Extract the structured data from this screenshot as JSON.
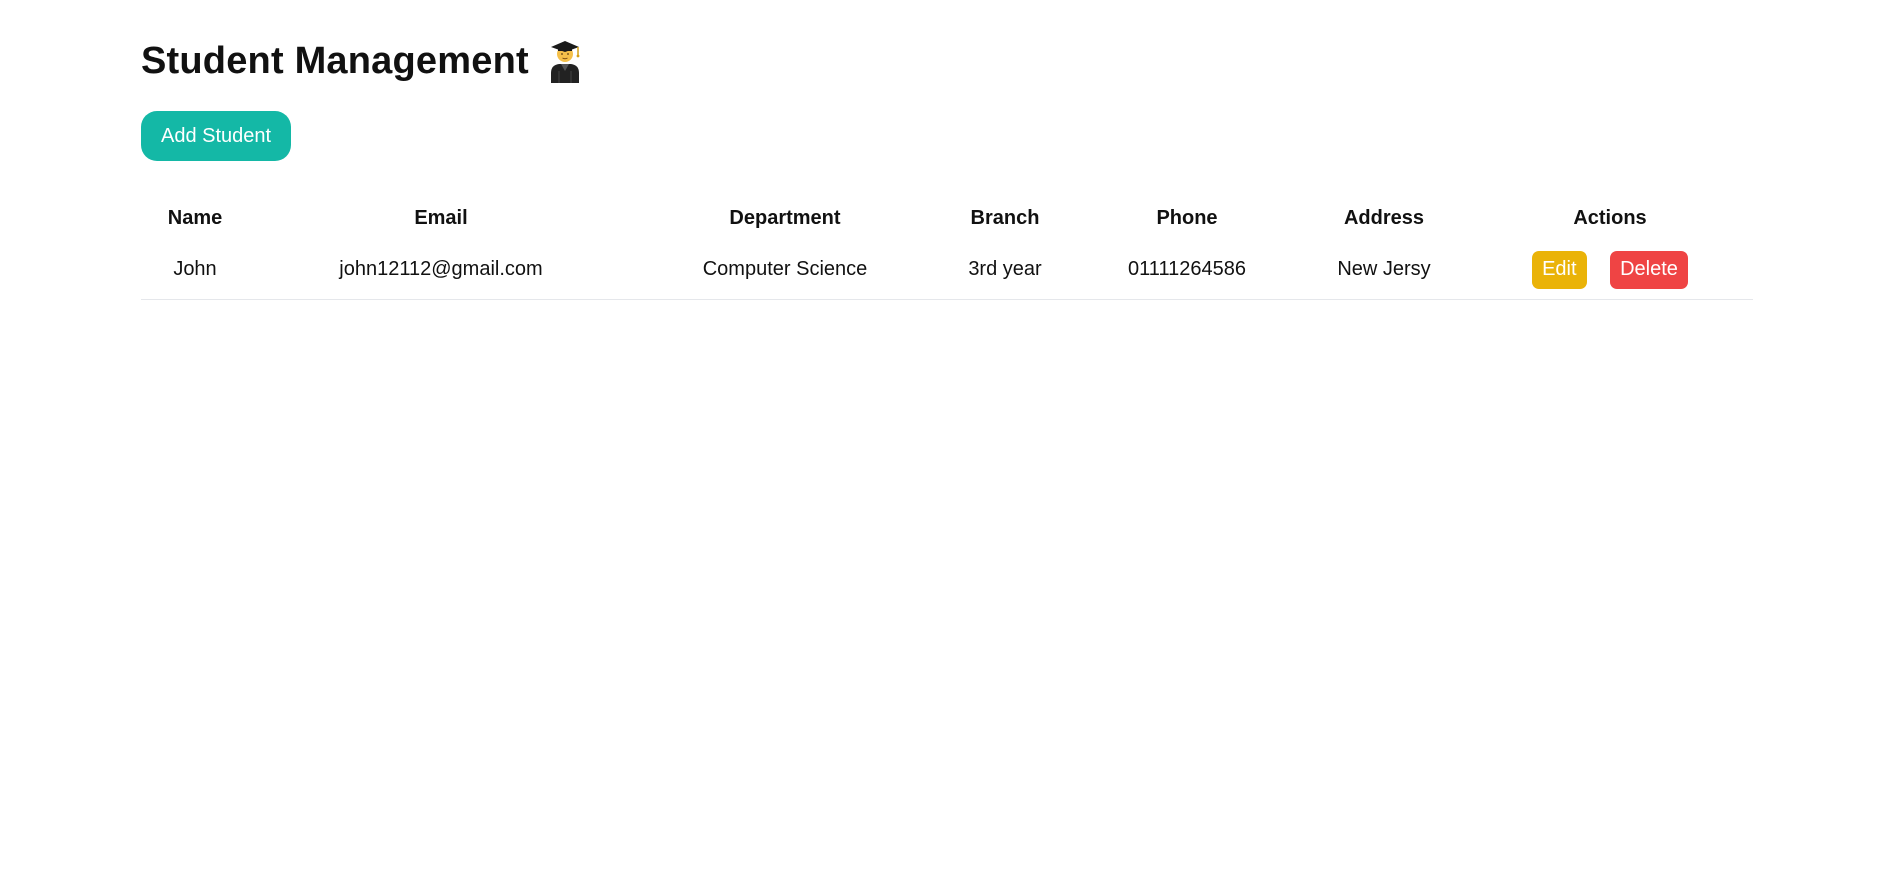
{
  "page": {
    "title": "Student Management",
    "title_icon": "graduate-student-icon"
  },
  "toolbar": {
    "add_label": "Add Student"
  },
  "table": {
    "headers": {
      "name": "Name",
      "email": "Email",
      "department": "Department",
      "branch": "Branch",
      "phone": "Phone",
      "address": "Address",
      "actions": "Actions"
    },
    "rows": [
      {
        "name": "John",
        "email": "john12112@gmail.com",
        "department": "Computer Science",
        "branch": "3rd year",
        "phone": "01111264586",
        "address": "New Jersy",
        "edit_label": "Edit",
        "delete_label": "Delete"
      }
    ]
  },
  "colors": {
    "accent": "#14b8a6",
    "edit": "#eab308",
    "delete": "#ef4444"
  }
}
